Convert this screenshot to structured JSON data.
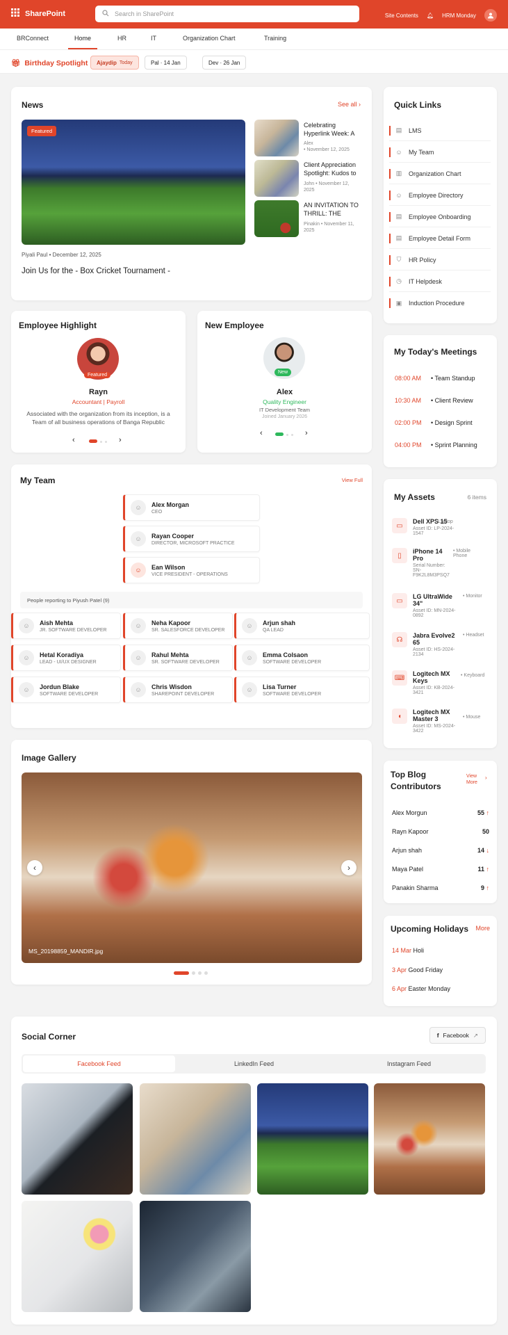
{
  "header": {
    "brand": "SharePoint",
    "search_placeholder": "Search in SharePoint",
    "site_contents": "Site Contents",
    "user": "HRM Monday"
  },
  "nav": {
    "items": [
      "BRConnect",
      "Home",
      "HR",
      "IT",
      "Organization Chart",
      "Training"
    ]
  },
  "birthday": {
    "title": "Birthday Spotlight",
    "today_name": "Ajaydip",
    "today_label": "Today",
    "chip2": "Pal · 14 Jan",
    "chip3": "Dev · 26 Jan"
  },
  "news": {
    "title": "News",
    "see_all": "See all",
    "featured": "Featured",
    "author_line": "Piyali Paul • December 12, 2025",
    "headline": "Join Us for the  - Box Cricket Tournament -",
    "side": [
      {
        "title": "Celebrating Hyperlink Week: A",
        "author": "Alex",
        "date": "• November 12, 2025"
      },
      {
        "title": "Client Appreciation Spotlight: Kudos to",
        "author": "John • November 12, 2025",
        "date": ""
      },
      {
        "title": "AN INVITATION TO THRILL: THE",
        "author": "Pinakin • November 11, 2025",
        "date": ""
      }
    ]
  },
  "quick_links": {
    "title": "Quick Links",
    "items": [
      {
        "label": "LMS",
        "icon": "document-icon"
      },
      {
        "label": "My Team",
        "icon": "users-icon"
      },
      {
        "label": "Organization Chart",
        "icon": "chart-icon"
      },
      {
        "label": "Employee Directory",
        "icon": "user-icon"
      },
      {
        "label": "Employee Onboarding",
        "icon": "document-icon"
      },
      {
        "label": "Employee Detail Form",
        "icon": "document-icon"
      },
      {
        "label": "HR Policy",
        "icon": "shield-icon"
      },
      {
        "label": "IT Helpdesk",
        "icon": "clock-icon"
      },
      {
        "label": "Induction Procedure",
        "icon": "briefcase-icon"
      }
    ]
  },
  "highlight": {
    "title": "Employee Highlight",
    "badge": "Featured",
    "name": "Rayn",
    "role": "Accountant | Payroll",
    "desc": "Associated with the organization from its inception, is a Team of all business operations of Banga Republic"
  },
  "new_employee": {
    "title": "New Employee",
    "badge": "New",
    "name": "Alex",
    "role": "Quality Engineer",
    "team": "IT Development Team",
    "joined": "Joined January 2026"
  },
  "meetings": {
    "title": "My Today's Meetings",
    "items": [
      {
        "time": "08:00 AM",
        "name": "Team Standup"
      },
      {
        "time": "10:30 AM",
        "name": "Client Review"
      },
      {
        "time": "02:00 PM",
        "name": "Design Sprint"
      },
      {
        "time": "04:00 PM",
        "name": "Sprint Planning"
      }
    ]
  },
  "team": {
    "title": "My Team",
    "view_full": "View Full",
    "chain": [
      {
        "name": "Alex Morgan",
        "role": "CEO"
      },
      {
        "name": "Rayan Cooper",
        "role": "DIRECTOR, MICROSOFT PRACTICE"
      },
      {
        "name": "Ean Wilson",
        "role": "VICE PRESIDENT - OPERATIONS"
      }
    ],
    "reporting_label": "People reporting to Piyush Patel (9)",
    "reports": [
      {
        "name": "Aish Mehta",
        "role": "JR. SOFTWARE DEVELOPER"
      },
      {
        "name": "Neha Kapoor",
        "role": "SR. SALESFORCE DEVELOPER"
      },
      {
        "name": "Arjun shah",
        "role": "QA LEAD"
      },
      {
        "name": "Hetal Koradiya",
        "role": "LEAD - UI/UX DESIGNER"
      },
      {
        "name": "Rahul Mehta",
        "role": "SR. SOFTWARE DEVELOPER"
      },
      {
        "name": "Emma Colsaon",
        "role": "SOFTWARE DEVELOPER"
      },
      {
        "name": "Jordun Blake",
        "role": "SOFTWARE DEVELOPER"
      },
      {
        "name": "Chris Wisdon",
        "role": "SHAREPOINT DEVELOPER"
      },
      {
        "name": "Lisa Turner",
        "role": "SOFTWARE DEVELOPER"
      }
    ]
  },
  "assets": {
    "title": "My Assets",
    "count": "6 items",
    "items": [
      {
        "name": "Dell XPS 15",
        "type": "• Laptop",
        "id": "Asset ID: LP-2024-1547",
        "icon": "laptop-icon"
      },
      {
        "name": "iPhone 14 Pro",
        "type": "• Mobile Phone",
        "id": "Serial Number: SN-F9K2L8M3PSQ7",
        "icon": "phone-icon"
      },
      {
        "name": "LG UltraWide 34\"",
        "type": "• Monitor",
        "id": "Asset ID: MN-2024-0892",
        "icon": "monitor-icon"
      },
      {
        "name": "Jabra Evolve2 65",
        "type": "• Headset",
        "id": "Asset ID: HS-2024-2134",
        "icon": "headset-icon"
      },
      {
        "name": "Logitech MX Keys",
        "type": "• Keyboard",
        "id": "Asset ID: KB-2024-3421",
        "icon": "keyboard-icon"
      },
      {
        "name": "Logitech MX Master 3",
        "type": "• Mouse",
        "id": "Asset ID: MS-2024-3422",
        "icon": "mouse-icon"
      }
    ]
  },
  "gallery": {
    "title": "Image Gallery",
    "caption": "MS_20198859_MANDIR.jpg"
  },
  "blog": {
    "title": "Top Blog Contributors",
    "view_more": "View More",
    "items": [
      {
        "name": "Alex Morgun",
        "count": "55",
        "trend": "↑"
      },
      {
        "name": "Rayn Kapoor",
        "count": "50",
        "trend": ""
      },
      {
        "name": "Arjun shah",
        "count": "14",
        "trend": "↓"
      },
      {
        "name": "Maya Patel",
        "count": "11",
        "trend": "↑"
      },
      {
        "name": "Panakin Sharma",
        "count": "9",
        "trend": "↑"
      }
    ]
  },
  "holidays": {
    "title": "Upcoming Holidays",
    "more": "More",
    "items": [
      {
        "date": "14 Mar",
        "name": "Holi"
      },
      {
        "date": "3 Apr",
        "name": "Good Friday"
      },
      {
        "date": "6 Apr",
        "name": "Easter Monday"
      }
    ]
  },
  "social": {
    "title": "Social Corner",
    "button": "Facebook",
    "tabs": [
      "Facebook Feed",
      "LinkedIn Feed",
      "Instagram Feed"
    ]
  },
  "colors": {
    "accent": "#e0452a",
    "success": "#2eb85c"
  }
}
